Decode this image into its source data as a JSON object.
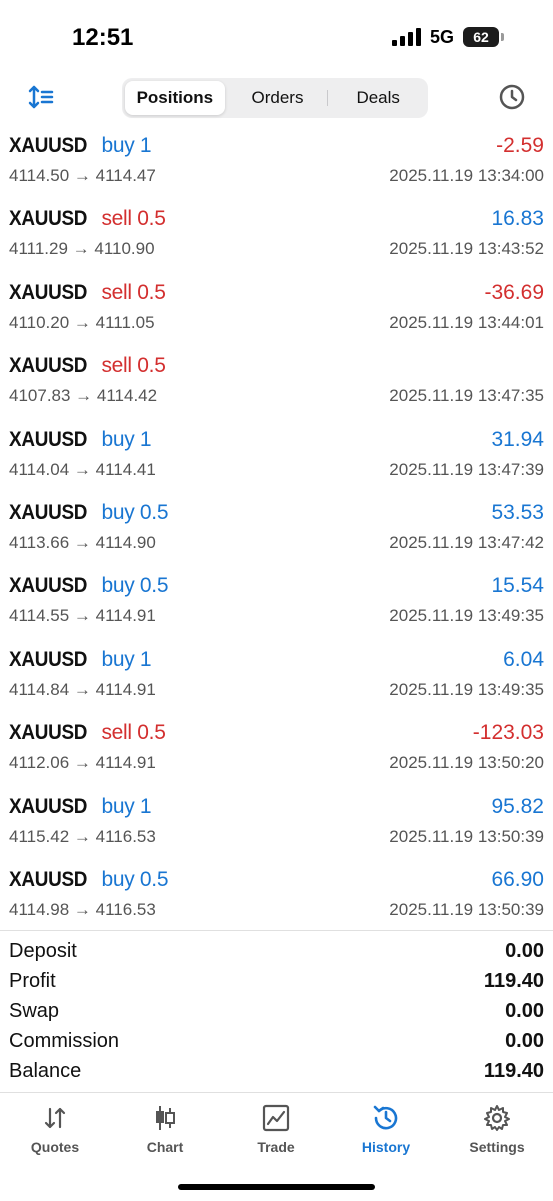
{
  "status": {
    "time": "12:51",
    "network": "5G",
    "battery": "62"
  },
  "tabs": {
    "positions": "Positions",
    "orders": "Orders",
    "deals": "Deals"
  },
  "rows": [
    {
      "symbol": "XAUUSD",
      "side": "buy 1",
      "type": "buy",
      "prices": "4114.50 → 4114.47",
      "profit": "-2.59",
      "time": "2025.11.19 13:34:00"
    },
    {
      "symbol": "XAUUSD",
      "side": "sell 0.5",
      "type": "sell",
      "prices": "4111.29 → 4110.90",
      "profit": "16.83",
      "time": "2025.11.19 13:43:52"
    },
    {
      "symbol": "XAUUSD",
      "side": "sell 0.5",
      "type": "sell",
      "prices": "4110.20 → 4111.05",
      "profit": "-36.69",
      "time": "2025.11.19 13:44:01"
    },
    {
      "symbol": "XAUUSD",
      "side": "sell 0.5",
      "type": "sell",
      "prices": "4107.83 → 4114.42",
      "profit": "",
      "time": "2025.11.19 13:47:35"
    },
    {
      "symbol": "XAUUSD",
      "side": "buy 1",
      "type": "buy",
      "prices": "4114.04 → 4114.41",
      "profit": "31.94",
      "time": "2025.11.19 13:47:39"
    },
    {
      "symbol": "XAUUSD",
      "side": "buy 0.5",
      "type": "buy",
      "prices": "4113.66 → 4114.90",
      "profit": "53.53",
      "time": "2025.11.19 13:47:42"
    },
    {
      "symbol": "XAUUSD",
      "side": "buy 0.5",
      "type": "buy",
      "prices": "4114.55 → 4114.91",
      "profit": "15.54",
      "time": "2025.11.19 13:49:35"
    },
    {
      "symbol": "XAUUSD",
      "side": "buy 1",
      "type": "buy",
      "prices": "4114.84 → 4114.91",
      "profit": "6.04",
      "time": "2025.11.19 13:49:35"
    },
    {
      "symbol": "XAUUSD",
      "side": "sell 0.5",
      "type": "sell",
      "prices": "4112.06 → 4114.91",
      "profit": "-123.03",
      "time": "2025.11.19 13:50:20"
    },
    {
      "symbol": "XAUUSD",
      "side": "buy 1",
      "type": "buy",
      "prices": "4115.42 → 4116.53",
      "profit": "95.82",
      "time": "2025.11.19 13:50:39"
    },
    {
      "symbol": "XAUUSD",
      "side": "buy 0.5",
      "type": "buy",
      "prices": "4114.98 → 4116.53",
      "profit": "66.90",
      "time": "2025.11.19 13:50:39"
    }
  ],
  "summary": {
    "deposit_label": "Deposit",
    "deposit": "0.00",
    "profit_label": "Profit",
    "profit": "119.40",
    "swap_label": "Swap",
    "swap": "0.00",
    "commission_label": "Commission",
    "commission": "0.00",
    "balance_label": "Balance",
    "balance": "119.40"
  },
  "nav": {
    "quotes": "Quotes",
    "chart": "Chart",
    "trade": "Trade",
    "history": "History",
    "settings": "Settings",
    "active": "history"
  },
  "colors": {
    "accent": "#1976d2",
    "negative": "#d32f2f",
    "icon_gray": "#555555"
  },
  "icons": [
    "sort-icon",
    "clock-icon",
    "quotes-icon",
    "chart-icon",
    "trade-icon",
    "history-icon",
    "settings-icon"
  ]
}
